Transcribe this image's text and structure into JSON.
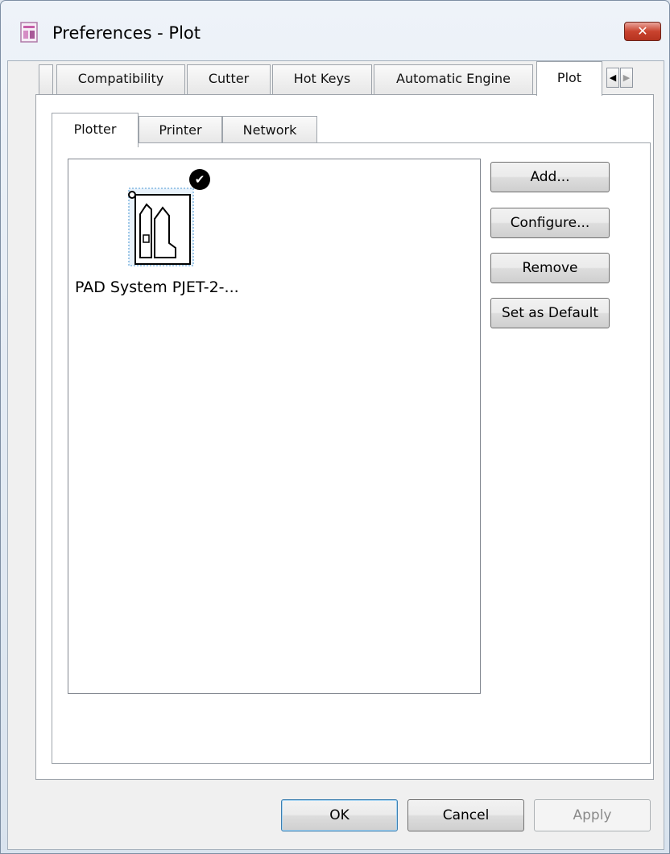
{
  "window": {
    "title": "Preferences - Plot",
    "icon": "app-icon",
    "close_label": "✕"
  },
  "tabs": [
    {
      "label": "Compatibility"
    },
    {
      "label": "Cutter"
    },
    {
      "label": "Hot Keys"
    },
    {
      "label": "Automatic Engine"
    },
    {
      "label": "Plot",
      "active": true
    }
  ],
  "subtabs": [
    {
      "label": "Plotter",
      "active": true
    },
    {
      "label": "Printer"
    },
    {
      "label": "Network"
    }
  ],
  "plotter_list": {
    "items": [
      {
        "label": "PAD System PJET-2-...",
        "is_default": true,
        "icon": "plotter-icon"
      }
    ]
  },
  "side_buttons": {
    "add": "Add...",
    "configure": "Configure...",
    "remove": "Remove",
    "set_default": "Set as Default"
  },
  "footer": {
    "ok": "OK",
    "cancel": "Cancel",
    "apply": "Apply"
  },
  "colors": {
    "close_button": "#c9432e",
    "selection_outline": "#9fc8e8"
  }
}
